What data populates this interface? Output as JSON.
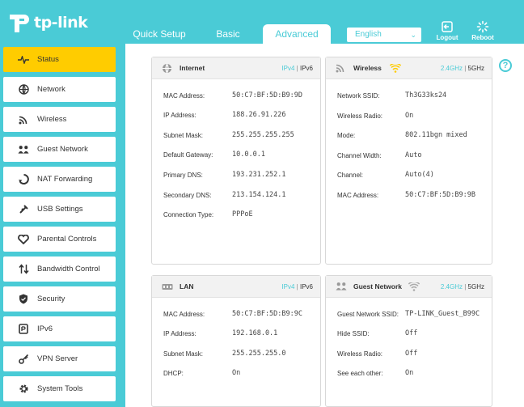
{
  "brand": {
    "logo_text": "tp-link"
  },
  "nav": {
    "tabs": [
      {
        "label": "Quick Setup"
      },
      {
        "label": "Basic"
      },
      {
        "label": "Advanced"
      }
    ],
    "language": "English",
    "logout_label": "Logout",
    "reboot_label": "Reboot"
  },
  "sidebar": {
    "items": [
      {
        "label": "Status",
        "icon": "pulse-icon"
      },
      {
        "label": "Network",
        "icon": "globe-icon"
      },
      {
        "label": "Wireless",
        "icon": "wifi-icon"
      },
      {
        "label": "Guest Network",
        "icon": "guest-users-icon"
      },
      {
        "label": "NAT Forwarding",
        "icon": "nat-icon"
      },
      {
        "label": "USB Settings",
        "icon": "usb-icon"
      },
      {
        "label": "Parental Controls",
        "icon": "heart-icon"
      },
      {
        "label": "Bandwidth Control",
        "icon": "updown-arrows-icon"
      },
      {
        "label": "Security",
        "icon": "shield-icon"
      },
      {
        "label": "IPv6",
        "icon": "ipv6-icon"
      },
      {
        "label": "VPN Server",
        "icon": "key-icon"
      },
      {
        "label": "System Tools",
        "icon": "gear-icon"
      }
    ]
  },
  "internet": {
    "title": "Internet",
    "ipv4": "IPv4",
    "ipv6": "IPv6",
    "rows": [
      {
        "label": "MAC Address:",
        "value": "50:C7:BF:5D:B9:9D"
      },
      {
        "label": "IP Address:",
        "value": "188.26.91.226"
      },
      {
        "label": "Subnet Mask:",
        "value": "255.255.255.255"
      },
      {
        "label": "Default Gateway:",
        "value": "10.0.0.1"
      },
      {
        "label": "Primary DNS:",
        "value": "193.231.252.1"
      },
      {
        "label": "Secondary DNS:",
        "value": "213.154.124.1"
      },
      {
        "label": "Connection Type:",
        "value": "PPPoE"
      }
    ]
  },
  "wireless": {
    "title": "Wireless",
    "band1": "2.4GHz",
    "band2": "5GHz",
    "rows": [
      {
        "label": "Network SSID:",
        "value": "Th3G33ks24"
      },
      {
        "label": "Wireless Radio:",
        "value": "On"
      },
      {
        "label": "Mode:",
        "value": "802.11bgn mixed"
      },
      {
        "label": "Channel Width:",
        "value": "Auto"
      },
      {
        "label": "Channel:",
        "value": "Auto(4)"
      },
      {
        "label": "MAC Address:",
        "value": "50:C7:BF:5D:B9:9B"
      }
    ]
  },
  "lan": {
    "title": "LAN",
    "ipv4": "IPv4",
    "ipv6": "IPv6",
    "rows": [
      {
        "label": "MAC Address:",
        "value": "50:C7:BF:5D:B9:9C"
      },
      {
        "label": "IP Address:",
        "value": "192.168.0.1"
      },
      {
        "label": "Subnet Mask:",
        "value": "255.255.255.0"
      },
      {
        "label": "DHCP:",
        "value": "On"
      }
    ]
  },
  "guest": {
    "title": "Guest Network",
    "band1": "2.4GHz",
    "band2": "5GHz",
    "rows": [
      {
        "label": "Guest Network SSID:",
        "value": "TP-LINK_Guest_B99C"
      },
      {
        "label": "Hide SSID:",
        "value": "Off"
      },
      {
        "label": "Wireless Radio:",
        "value": "Off"
      },
      {
        "label": "See each other:",
        "value": "On"
      }
    ]
  },
  "help_label": "?",
  "colors": {
    "accent": "#4acbd6",
    "active": "#ffcc00",
    "wifi_on": "#ffcc00"
  }
}
